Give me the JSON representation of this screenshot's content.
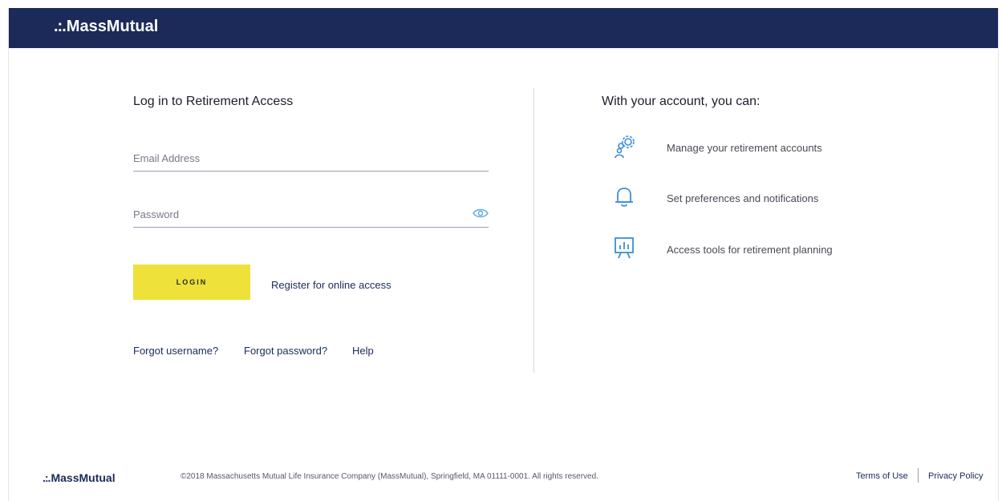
{
  "header": {
    "logo_dots": ".:.",
    "logo_text": "MassMutual"
  },
  "login": {
    "title": "Log in to Retirement Access",
    "email_placeholder": "Email Address",
    "email_value": "",
    "password_placeholder": "Password",
    "password_value": "",
    "login_button": "LOGIN",
    "register_link": "Register for online access",
    "forgot_username": "Forgot username?",
    "forgot_password": "Forgot password?",
    "help": "Help"
  },
  "features": {
    "title": "With your account, you can:",
    "items": [
      {
        "icon": "gears-person-icon",
        "text": "Manage your retirement accounts"
      },
      {
        "icon": "bell-icon",
        "text": "Set preferences and notifications"
      },
      {
        "icon": "chart-board-icon",
        "text": "Access tools for retirement planning"
      }
    ]
  },
  "footer": {
    "logo_dots": ".:.",
    "logo_text": "MassMutual",
    "copyright": "©2018 Massachusetts Mutual Life Insurance Company (MassMutual), Springfield, MA 01111-0001. All rights reserved.",
    "terms": "Terms of Use",
    "privacy": "Privacy Policy"
  },
  "colors": {
    "navy": "#1c2a5a",
    "yellow": "#ede13a",
    "icon_blue": "#3b8fd6"
  }
}
